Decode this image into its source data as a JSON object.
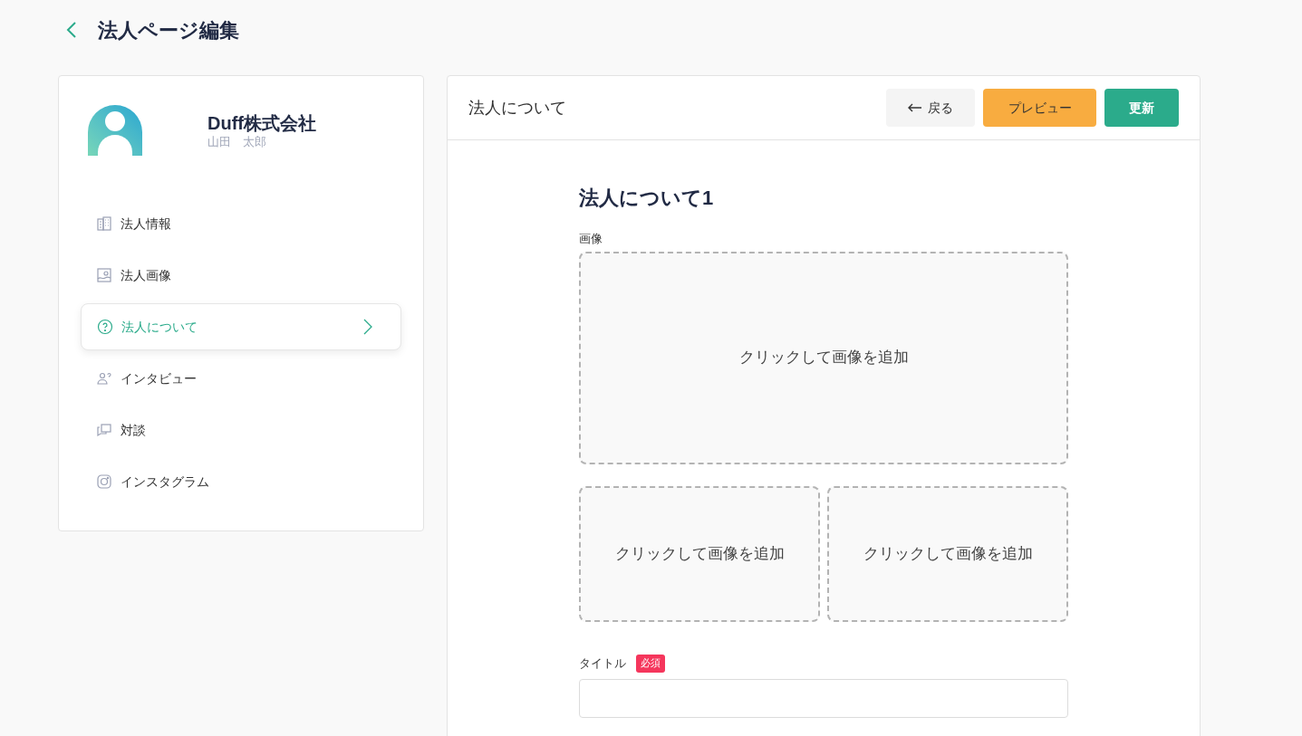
{
  "page": {
    "title": "法人ページ編集"
  },
  "profile": {
    "company": "Duff株式会社",
    "person": "山田　太郎"
  },
  "nav": [
    {
      "label": "法人情報",
      "kind": "building",
      "selected": false
    },
    {
      "label": "法人画像",
      "kind": "image",
      "selected": false
    },
    {
      "label": "法人について",
      "kind": "question",
      "selected": true
    },
    {
      "label": "インタビュー",
      "kind": "interview",
      "selected": false
    },
    {
      "label": "対談",
      "kind": "chat",
      "selected": false
    },
    {
      "label": "インスタグラム",
      "kind": "instagram",
      "selected": false
    }
  ],
  "panel": {
    "title": "法人について",
    "buttons": [
      {
        "label": "戻る",
        "kind": "back"
      },
      {
        "label": "プレビュー",
        "kind": "preview"
      },
      {
        "label": "更新",
        "kind": "update"
      }
    ]
  },
  "section": {
    "heading": "法人について1",
    "image_label": "画像",
    "uploads": [
      "クリックして画像を追加",
      "クリックして画像を追加",
      "クリックして画像を追加"
    ],
    "title_label": "タイトル",
    "required_badge": "必須"
  }
}
